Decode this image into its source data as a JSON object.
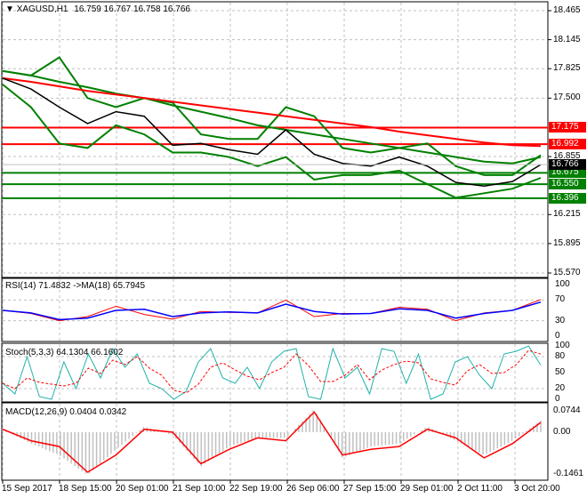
{
  "header": {
    "symbol": "XAGUSD,H1",
    "ohlc": "16.759 16.767 16.758 16.766"
  },
  "colors": {
    "bid_line": "#000000",
    "levels_red": "#ff0000",
    "levels_green": "#008000",
    "ma_slow": "#ff0000",
    "ma_mid": "#008000",
    "bands": "#008000",
    "rsi": "#ff0000",
    "rsi_ma": "#0000ff",
    "stoch_main": "#20b2aa",
    "stoch_signal": "#ff0000",
    "macd_hist": "#c0c0c0",
    "macd_signal": "#ff0000"
  },
  "chart_data": [
    {
      "type": "line",
      "title": "XAGUSD,H1",
      "x_ticks": [
        "15 Sep 2017",
        "18 Sep 15:00",
        "20 Sep 01:00",
        "21 Sep 10:00",
        "22 Sep 19:00",
        "26 Sep 06:00",
        "27 Sep 15:00",
        "29 Sep 01:00",
        "2 Oct 11:00",
        "3 Oct 20:00"
      ],
      "y_ticks": [
        "18.465",
        "18.145",
        "17.825",
        "17.500",
        "16.855",
        "16.215",
        "15.895",
        "15.570"
      ],
      "ylim": [
        15.57,
        18.465
      ],
      "grid": true,
      "series": [
        {
          "role": "price",
          "values": [
            17.72,
            17.6,
            17.4,
            17.22,
            17.35,
            17.3,
            16.98,
            17.0,
            16.93,
            16.88,
            17.15,
            16.88,
            16.78,
            16.75,
            16.85,
            16.75,
            16.57,
            16.53,
            16.58,
            16.766
          ]
        },
        {
          "role": "ma_slow",
          "values": [
            17.72,
            17.68,
            17.63,
            17.58,
            17.54,
            17.5,
            17.46,
            17.42,
            17.38,
            17.34,
            17.3,
            17.26,
            17.22,
            17.18,
            17.13,
            17.09,
            17.05,
            17.01,
            16.98,
            16.97
          ]
        },
        {
          "role": "ma_mid",
          "values": [
            17.8,
            17.75,
            17.68,
            17.62,
            17.55,
            17.5,
            17.42,
            17.35,
            17.28,
            17.2,
            17.15,
            17.1,
            17.05,
            17.0,
            16.95,
            16.9,
            16.85,
            16.8,
            16.78,
            16.85
          ]
        },
        {
          "role": "band_upper",
          "values": [
            17.8,
            17.75,
            17.95,
            17.5,
            17.4,
            17.5,
            17.45,
            17.1,
            17.05,
            17.05,
            17.4,
            17.3,
            16.95,
            16.9,
            16.95,
            17.0,
            16.75,
            16.65,
            16.65,
            16.87
          ]
        },
        {
          "role": "band_lower",
          "values": [
            17.65,
            17.4,
            17.0,
            16.95,
            17.2,
            17.1,
            16.9,
            16.9,
            16.85,
            16.75,
            16.85,
            16.6,
            16.65,
            16.65,
            16.7,
            16.55,
            16.4,
            16.45,
            16.5,
            16.62
          ]
        }
      ],
      "levels": [
        {
          "value": "17.175",
          "color": "red"
        },
        {
          "value": "16.992",
          "color": "red"
        },
        {
          "value": "16.675",
          "color": "green"
        },
        {
          "value": "16.550",
          "color": "green"
        },
        {
          "value": "16.396",
          "color": "green"
        }
      ],
      "current_price": "16.766"
    },
    {
      "type": "line",
      "title": "RSI(14) 71.4832  ->MA(18) 65.7945",
      "y_ticks": [
        "100",
        "70",
        "30",
        "0"
      ],
      "ylim": [
        0,
        100
      ],
      "series": [
        {
          "role": "rsi",
          "values": [
            50,
            44,
            30,
            38,
            58,
            42,
            33,
            48,
            46,
            45,
            70,
            38,
            44,
            44,
            56,
            52,
            30,
            45,
            50,
            71
          ]
        },
        {
          "role": "ma",
          "values": [
            50,
            45,
            32,
            35,
            50,
            52,
            38,
            45,
            47,
            45,
            62,
            48,
            43,
            44,
            53,
            50,
            35,
            44,
            50,
            66
          ]
        }
      ]
    },
    {
      "type": "line",
      "title": "Stoch(5,3,3) 64.1304 66.1602",
      "y_ticks": [
        "100",
        "80",
        "50",
        "20",
        "0"
      ],
      "ylim": [
        0,
        100
      ],
      "series": [
        {
          "role": "main",
          "values": [
            30,
            10,
            80,
            5,
            0,
            70,
            20,
            85,
            40,
            95,
            60,
            85,
            30,
            20,
            0,
            15,
            70,
            95,
            40,
            30,
            60,
            20,
            70,
            90,
            95,
            5,
            0,
            95,
            40,
            60,
            10,
            95,
            90,
            30,
            85,
            0,
            10,
            70,
            80,
            45,
            20,
            85,
            90,
            100,
            64
          ]
        }
      ]
    },
    {
      "type": "bar",
      "title": "MACD(12,26,9) 0.0404 0.0342",
      "y_ticks": [
        "0.0744",
        "0.00",
        "-0.1461"
      ],
      "ylim": [
        -0.1461,
        0.0744
      ],
      "series": [
        {
          "role": "histogram",
          "values": [
            0.01,
            -0.04,
            -0.08,
            -0.15,
            -0.06,
            0.02,
            -0.01,
            -0.12,
            -0.05,
            -0.02,
            -0.02,
            0.08,
            -0.09,
            -0.05,
            -0.04,
            0.02,
            -0.03,
            -0.08,
            -0.03,
            0.04
          ]
        },
        {
          "role": "signal",
          "values": [
            0.01,
            -0.03,
            -0.05,
            -0.14,
            -0.08,
            0.01,
            0.0,
            -0.11,
            -0.06,
            -0.02,
            -0.03,
            0.07,
            -0.08,
            -0.06,
            -0.05,
            0.01,
            -0.02,
            -0.09,
            -0.04,
            0.034
          ]
        }
      ]
    }
  ]
}
